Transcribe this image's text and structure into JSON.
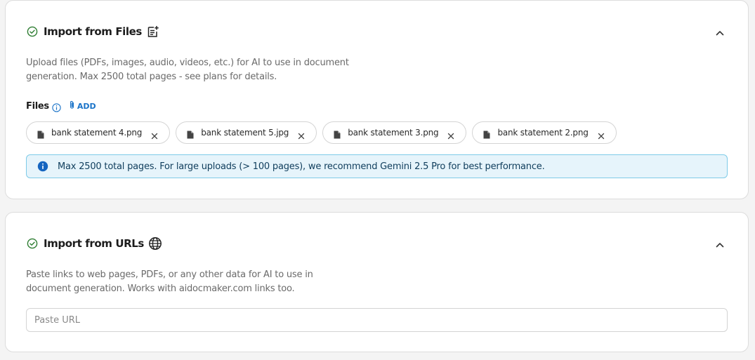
{
  "files_section": {
    "title": "Import from Files",
    "description": "Upload files (PDFs, images, audio, videos, etc.) for AI to use in document generation. Max 2500 total pages - see plans for details.",
    "files_label": "Files",
    "add_label": "ADD",
    "files": [
      {
        "name": "bank statement 4.png"
      },
      {
        "name": "bank statement 5.jpg"
      },
      {
        "name": "bank statement 3.png"
      },
      {
        "name": "bank statement 2.png"
      }
    ],
    "info_banner": "Max 2500 total pages. For large uploads (> 100 pages), we recommend Gemini 2.5 Pro for best performance."
  },
  "urls_section": {
    "title": "Import from URLs",
    "description": "Paste links to web pages, PDFs, or any other data for AI to use in document generation. Works with aidocmaker.com links too.",
    "url_placeholder": "Paste URL",
    "url_value": ""
  },
  "icons": {
    "status": "check-circle-icon",
    "files_title": "document-add-icon",
    "urls_title": "globe-icon",
    "collapse": "chevron-up-icon",
    "info": "info-icon",
    "attach": "paperclip-icon",
    "file": "file-icon",
    "remove": "close-icon"
  },
  "colors": {
    "success": "#2e7d32",
    "link": "#1a73c8",
    "banner_bg": "#e6f4fb",
    "banner_border": "#7ecbe8",
    "banner_icon": "#1565c0"
  }
}
